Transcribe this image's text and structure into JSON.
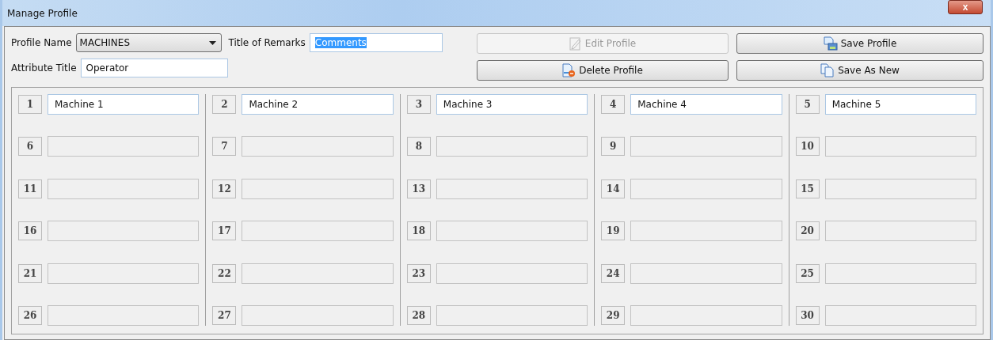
{
  "window": {
    "title": "Manage Profile",
    "close_label": "x"
  },
  "profile_name": {
    "label": "Profile Name",
    "value": "MACHINES"
  },
  "remarks_title": {
    "label": "Title of Remarks",
    "value": "Comments",
    "text_selected": true
  },
  "attribute_title": {
    "label": "Attribute Title",
    "value": "Operator"
  },
  "buttons": [
    {
      "label": "Edit Profile",
      "kind": "edit",
      "disabled": true
    },
    {
      "label": "Save Profile",
      "kind": "save",
      "disabled": false
    },
    {
      "label": "Delete Profile",
      "kind": "delete",
      "disabled": false
    },
    {
      "label": "Save As New",
      "kind": "copy",
      "disabled": false
    }
  ],
  "columns": [
    {
      "slots": [
        {
          "number": "1",
          "value": "Machine 1",
          "disabled": false
        },
        {
          "number": "6",
          "disabled": true
        },
        {
          "number": "11",
          "disabled": true
        },
        {
          "number": "16",
          "disabled": true
        },
        {
          "number": "21",
          "disabled": true
        },
        {
          "number": "26",
          "disabled": true
        }
      ]
    },
    {
      "slots": [
        {
          "number": "2",
          "value": "Machine 2",
          "disabled": false
        },
        {
          "number": "7",
          "disabled": true
        },
        {
          "number": "12",
          "disabled": true
        },
        {
          "number": "17",
          "disabled": true
        },
        {
          "number": "22",
          "disabled": true
        },
        {
          "number": "27",
          "disabled": true
        }
      ]
    },
    {
      "slots": [
        {
          "number": "3",
          "value": "Machine 3",
          "disabled": false
        },
        {
          "number": "8",
          "disabled": true
        },
        {
          "number": "13",
          "disabled": true
        },
        {
          "number": "18",
          "disabled": true
        },
        {
          "number": "23",
          "disabled": true
        },
        {
          "number": "28",
          "disabled": true
        }
      ]
    },
    {
      "slots": [
        {
          "number": "4",
          "value": "Machine 4",
          "disabled": false
        },
        {
          "number": "9",
          "disabled": true
        },
        {
          "number": "14",
          "disabled": true
        },
        {
          "number": "19",
          "disabled": true
        },
        {
          "number": "24",
          "disabled": true
        },
        {
          "number": "29",
          "disabled": true
        }
      ]
    },
    {
      "slots": [
        {
          "number": "5",
          "value": "Machine 5",
          "disabled": false
        },
        {
          "number": "10",
          "disabled": true
        },
        {
          "number": "15",
          "disabled": true
        },
        {
          "number": "20",
          "disabled": true
        },
        {
          "number": "25",
          "disabled": true
        },
        {
          "number": "30",
          "disabled": true
        }
      ]
    }
  ]
}
